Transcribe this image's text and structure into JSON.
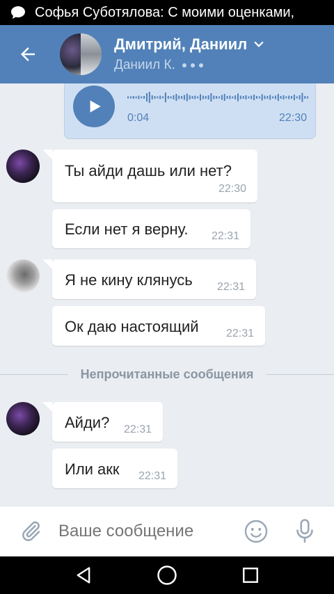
{
  "status_bar": {
    "notification_text": "Софья Суботялова: С моими оценками,",
    "notification_icon": "chat-bubble-icon"
  },
  "header": {
    "title": "Дмитрий, Даниил",
    "subtitle": "Даниил К.",
    "background_color": "#5181b8"
  },
  "voice_message": {
    "duration": "0:04",
    "time": "22:30"
  },
  "messages": [
    {
      "text": "Ты айди дашь или нет?",
      "time": "22:30"
    },
    {
      "text": "Если нет я верну.",
      "time": "22:31"
    },
    {
      "text": "Я не кину клянусь",
      "time": "22:31"
    },
    {
      "text": "Ок даю настоящий",
      "time": "22:31"
    },
    {
      "text": "Айди?",
      "time": "22:31"
    },
    {
      "text": "Или акк",
      "time": "22:31"
    }
  ],
  "unread_divider": "Непрочитанные сообщения",
  "composer": {
    "placeholder": "Ваше сообщение"
  },
  "navbar": {
    "icons": [
      "back-triangle-icon",
      "home-circle-icon",
      "recents-square-icon"
    ]
  }
}
